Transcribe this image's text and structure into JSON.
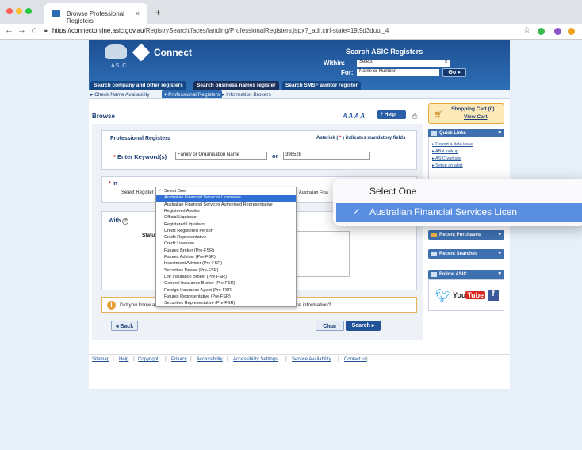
{
  "browser": {
    "tab_title": "Browse Professional Registers",
    "tab_close": "×",
    "new_tab": "+",
    "url_host": "https://connectonline.asic.gov.au",
    "url_path": "/RegistrySearch/faces/landing/ProfessionalRegisters.jspx?_adf.ctrl-state=19t9d3duui_4",
    "nav_back": "←",
    "nav_forward": "→",
    "nav_reload": "C",
    "star": "☆"
  },
  "header": {
    "agency": "ASIC",
    "brand": "Connect",
    "search_title": "Search ASIC Registers",
    "within_label": "Within:",
    "within_value": "Select",
    "for_label": "For:",
    "for_placeholder": "Name or Number",
    "go_label": "Go"
  },
  "search_tabs": [
    {
      "label": "Search company and other registers"
    },
    {
      "label": "Search business names register"
    },
    {
      "label": "Search SMSF auditor register"
    }
  ],
  "subnav": [
    {
      "label": "Check Name Availability"
    },
    {
      "label": "Professional Registers"
    },
    {
      "label": "Information Brokers"
    }
  ],
  "main": {
    "page_title": "Browse",
    "font_size_label": "A A A A",
    "help_label": "Help",
    "panel_title": "Professional Registers",
    "asterisk_note_pre": "Asterisk (",
    "asterisk_mark": "*",
    "asterisk_note_post": ") indicates mandatory fields",
    "keyword_label": "Enter Keyword(s)",
    "keyword_value": "Family or Organisation Name",
    "or_label": "or",
    "number_value": "398528",
    "in_label": "In",
    "select_register_label": "Select Register",
    "afs_label": "Australian Fina",
    "with_label": "With",
    "status_label": "Status",
    "info_text_start": "Did you know a",
    "info_text_end": "more information?",
    "back_label": "Back",
    "clear_label": "Clear",
    "search_label": "Search"
  },
  "sidebar": {
    "cart_title": "Shopping Cart (0)",
    "cart_view": "View Cart",
    "quick_links_title": "Quick Links",
    "quick_links": [
      {
        "label": "Report a data issue"
      },
      {
        "label": "ABN lookup"
      },
      {
        "label": "ASIC website"
      },
      {
        "label": "Setup an alert"
      }
    ],
    "recent_purchases": "Recent Purchases",
    "recent_searches": "Recent Searches",
    "follow_asic": "Follow ASIC",
    "youtube_pre": "You",
    "youtube_tube": "Tube",
    "facebook": "f"
  },
  "footer": {
    "links": [
      {
        "label": "Sitemap"
      },
      {
        "label": "Help"
      },
      {
        "label": "Copyright"
      },
      {
        "label": "Privacy"
      },
      {
        "label": "Accessibility"
      },
      {
        "label": "Accessibility Settings"
      },
      {
        "label": "Service Availability"
      },
      {
        "label": "Contact us"
      }
    ]
  },
  "dropdown": {
    "selected": "Select One",
    "options": [
      {
        "label": "Select One"
      },
      {
        "label": "Australian Financial Services Licensees"
      },
      {
        "label": "Australian Financial Services Authorised Representative"
      },
      {
        "label": "Registered Auditor"
      },
      {
        "label": "Official Liquidator"
      },
      {
        "label": "Registered Liquidator"
      },
      {
        "label": "Credit Registered Person"
      },
      {
        "label": "Credit Representative"
      },
      {
        "label": "Credit Licensee"
      },
      {
        "label": "Futures Broker (Pre-FSR)"
      },
      {
        "label": "Futures Adviser (Pre-FSR)"
      },
      {
        "label": "Investment Adviser (Pre-FSR)"
      },
      {
        "label": "Securities Dealer (Pre-FSR)"
      },
      {
        "label": "Life Insurance Broker (Pre-FSR)"
      },
      {
        "label": "General Insurance Broker (Pre-FSR)"
      },
      {
        "label": "Foreign Insurance Agent (Pre-FSR)"
      },
      {
        "label": "Futures Representative (Pre-FSR)"
      },
      {
        "label": "Securities Representative (Pre-FSR)"
      }
    ],
    "highlighted_index": 1,
    "checked_index": 0
  },
  "zoom": {
    "option1": "Select One",
    "option2": "Australian Financial Services Licen"
  },
  "colors": {
    "brand_blue": "#1e4f93",
    "highlight": "#2f6fd6",
    "required": "#dd2222"
  }
}
